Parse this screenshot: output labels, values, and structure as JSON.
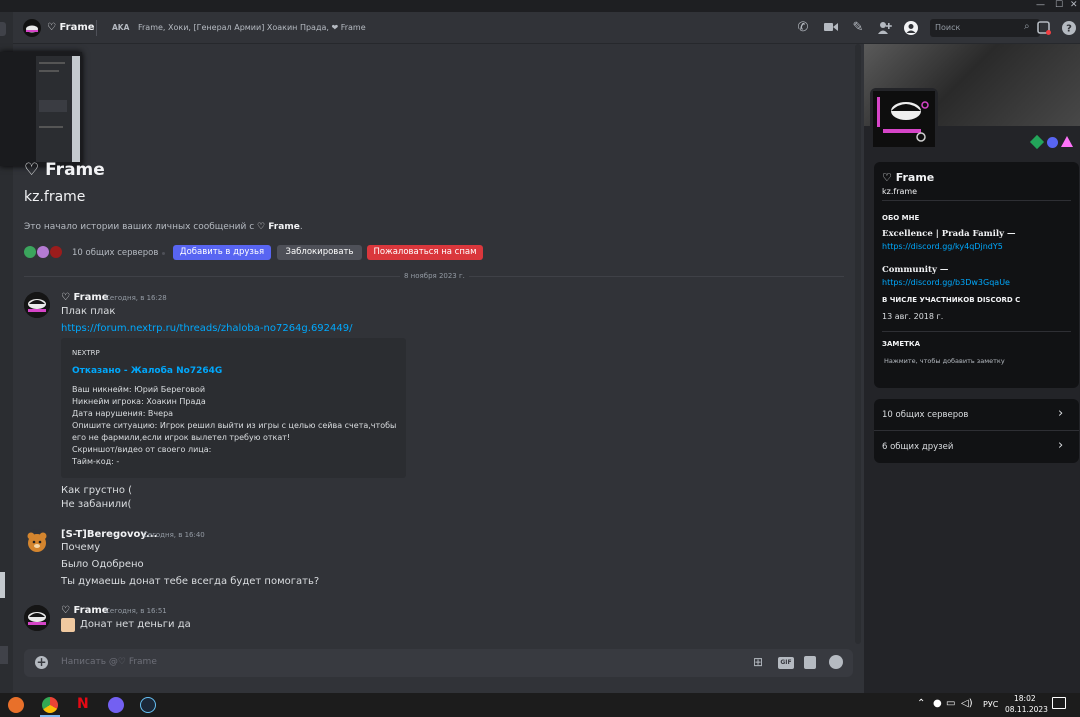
{
  "header": {
    "title": "♡ Frame",
    "aka_label": "AKA",
    "aka_names": "Frame, Хоки, [Генерал Армии] Хоакин Прада, ❤ Frame",
    "search_placeholder": "Поиск"
  },
  "intro": {
    "display_name": "♡ Frame",
    "username": "kz.frame",
    "history_text_prefix": "Это начало истории ваших личных сообщений с ",
    "history_text_name": "♡ Frame",
    "history_text_suffix": ".",
    "mutual_servers": "10 общих серверов",
    "add_friend": "Добавить в друзья",
    "block": "Заблокировать",
    "report_spam": "Пожаловаться на спам"
  },
  "date_divider": "8 ноября 2023 г.",
  "messages": [
    {
      "author": "♡ Frame",
      "timestamp": "Сегодня, в 16:28",
      "lines": [
        "Плак плак"
      ],
      "link": "https://forum.nextrp.ru/threads/zhaloba-no7264g.692449/",
      "embed": {
        "provider": "NEXTRP",
        "title": "Отказано - Жалоба No7264G",
        "description": [
          "Ваш никнейм: Юрий Береговой",
          "Никнейм игрока: Хоакин Прада",
          "Дата нарушения: Вчера",
          "Опишите ситуацию: Игрок решил выйти из игры с целью сейва счета,чтобы",
          "его не фармили,если игрок вылетел требую откат!",
          "Скриншот/видео от своего лица:",
          "Тайм-код: -"
        ]
      },
      "after_lines": [
        "Как грустно (",
        "Не забанили("
      ]
    },
    {
      "author": "[S-T]Beregovoy...",
      "timestamp": "Сегодня, в 16:40",
      "lines": [
        "Почему",
        "Было Одобрено",
        "Ты думаешь донат тебе всегда будет помогать?"
      ]
    },
    {
      "author": "♡ Frame",
      "timestamp": "Сегодня, в 16:51",
      "lines": [
        "Донат нет деньги да"
      ]
    }
  ],
  "composer": {
    "placeholder": "Написать @♡ Frame"
  },
  "profile": {
    "display_name": "♡ Frame",
    "username": "kz.frame",
    "about_heading": "ОБО МНЕ",
    "about_line1": "Excellence | Prada Family —",
    "about_link1": "https://discord.gg/ky4qDjndY5",
    "about_line2": "Community —",
    "about_link2": "https://discord.gg/b3Dw3GqaUe",
    "member_since_heading": "В ЧИСЛЕ УЧАСТНИКОВ DISCORD С",
    "member_since": "13 авг. 2018 г.",
    "note_heading": "ЗАМЕТКА",
    "note_placeholder": "Нажмите, чтобы добавить заметку",
    "mutual_servers": "10 общих серверов",
    "mutual_friends": "6 общих друзей"
  },
  "taskbar": {
    "lang": "РУС",
    "time": "18:02",
    "date": "08.11.2023"
  },
  "colors": {
    "accent_blurple": "#5865f2",
    "danger": "#da373c",
    "link": "#00a8fc",
    "background": "#313338"
  }
}
